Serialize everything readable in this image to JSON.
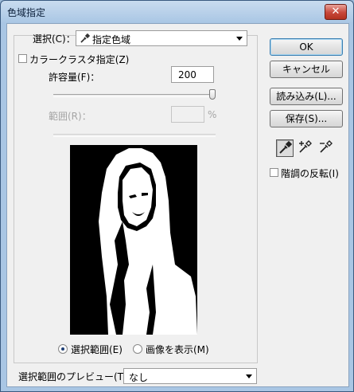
{
  "window": {
    "title": "色域指定",
    "close_glyph": "✕"
  },
  "select": {
    "label": "選択(C)：",
    "value": "指定色域",
    "icon": "eyedropper-icon"
  },
  "color_cluster": {
    "label": "カラークラスタ指定(Z)",
    "checked": false
  },
  "tolerance": {
    "label": "許容量(F)：",
    "value": "200",
    "slider_fraction": 1.0
  },
  "range": {
    "label": "範囲(R)：",
    "value": "",
    "unit": "%"
  },
  "view_options": [
    {
      "label": "選択範囲(E)",
      "selected": true
    },
    {
      "label": "画像を表示(M)",
      "selected": false
    }
  ],
  "selection_preview": {
    "label": "選択範囲のプレビュー(T)：",
    "value": "なし"
  },
  "buttons": {
    "ok": "OK",
    "cancel": "キャンセル",
    "load": "読み込み(L)...",
    "save": "保存(S)..."
  },
  "eyedroppers": [
    "eyedropper-icon",
    "eyedropper-plus-icon",
    "eyedropper-minus-icon"
  ],
  "invert": {
    "label": "階調の反転(I)",
    "checked": false
  },
  "colors": {
    "titlebar": "#a9c6e4",
    "close": "#c7473a",
    "dialog": "#f0f0f0"
  }
}
